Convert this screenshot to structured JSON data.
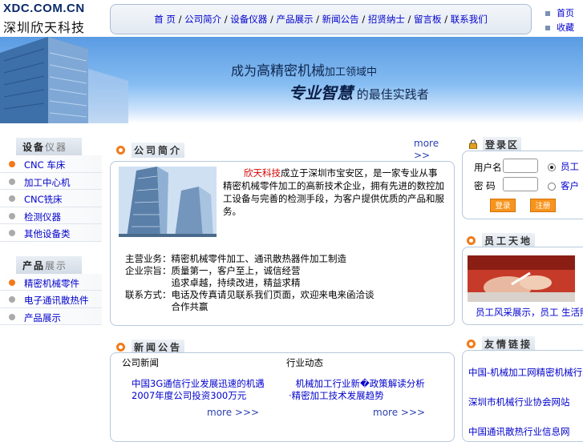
{
  "header": {
    "logo_line1": "XDC.COM.CN",
    "logo_line2": "深圳欣天科技",
    "nav": [
      "首 页",
      "公司简介",
      "设备仪器",
      "产品展示",
      "新闻公告",
      "招贤纳士",
      "留言板",
      "联系我们"
    ],
    "top_links": [
      "首页",
      "收藏"
    ]
  },
  "banner": {
    "line1_a": "成为",
    "line1_b": "高精密机械",
    "line1_c": "加工领域中",
    "line2_a": "专业智慧",
    "line2_b": "的最佳实践者"
  },
  "left": {
    "section1_title_a": "设备",
    "section1_title_b": "仪器",
    "equipment": [
      {
        "label": "CNC 车床",
        "active": true
      },
      {
        "label": "加工中心机",
        "active": false
      },
      {
        "label": "CNC铣床",
        "active": false
      },
      {
        "label": "检测仪器",
        "active": false
      },
      {
        "label": "其他设备类",
        "active": false
      }
    ],
    "section2_title_a": "产品",
    "section2_title_b": "展示",
    "products": [
      {
        "label": "精密机械零件",
        "active": true
      },
      {
        "label": "电子通讯散热件",
        "active": false
      },
      {
        "label": "产品展示",
        "active": false
      }
    ]
  },
  "intro": {
    "title": "公司简介",
    "more": "more >>",
    "highlight": "欣天科技",
    "text": "成立于深圳市宝安区，是一家专业从事精密机械零件加工的高新技术企业，拥有先进的数控加工设备与完善的检测手段，为客户提供优质的产品和服务。",
    "lines": [
      "主营业务：精密机械零件加工、通讯散热器件加工制造",
      "企业宗旨：质量第一，客户至上，诚信经营",
      "　　　　　追求卓越，持续改进，精益求精",
      "联系方式：电话及传真请见联系我们页面，欢迎来电来函洽谈",
      "　　　　　合作共赢"
    ]
  },
  "news": {
    "title": "新闻公告",
    "col1_title": "公司新闻",
    "col1_items": [
      "中国3G通信行业发展迅速的机遇",
      "2007年度公司投资300万元"
    ],
    "col1_more": "more >>>",
    "col2_title": "行业动态",
    "col2_items": [
      "　机械加工行业新�政策解读分析",
      "·精密加工技术发展趋势"
    ],
    "col2_more": "more >>>"
  },
  "login": {
    "title": "登录区",
    "user_label": "用户名",
    "pass_label": "密 码",
    "radio1": "员工",
    "radio2": "客户",
    "login_btn": "登录",
    "register_btn": "注册"
  },
  "staff": {
    "title": "员工天地",
    "caption": "员工风采展示，员工 生活照片"
  },
  "links": {
    "title": "友情链接",
    "items": [
      "中国-机械加工网精密机械行业门户",
      "深圳市机械行业协会网站",
      "中国通讯散热行业信息网"
    ]
  },
  "colors": {
    "accent": "#f27a1a",
    "link": "#0000cc",
    "banner": "#5a9be3"
  }
}
